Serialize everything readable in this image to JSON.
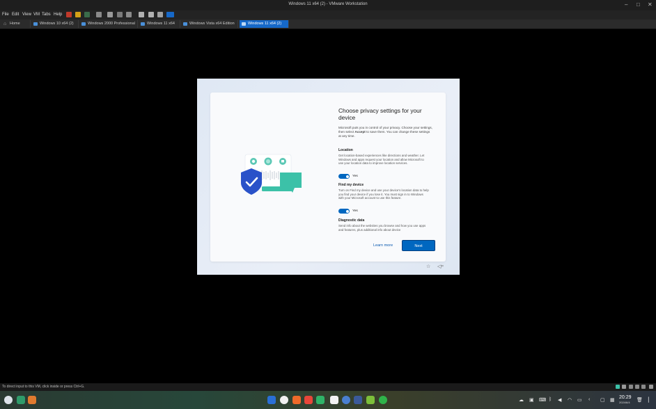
{
  "window": {
    "title": "Windows 11 x64 (2) - VMware Workstation"
  },
  "menu": [
    "File",
    "Edit",
    "View",
    "VM",
    "Tabs",
    "Help"
  ],
  "tabs": [
    {
      "label": "Home"
    },
    {
      "label": "Windows 10 x64 (2)"
    },
    {
      "label": "Windows 2000 Professional"
    },
    {
      "label": "Windows 11 x64"
    },
    {
      "label": "Windows Vista x64 Edition"
    },
    {
      "label": "Windows 11 x64 (2)"
    }
  ],
  "oobe": {
    "heading": "Choose privacy settings for your device",
    "description_pre": "Microsoft puts you in control of your privacy. Choose your settings, then select ",
    "description_bold": "Accept",
    "description_post": " to save them. You can change these settings at any time.",
    "sections": [
      {
        "title": "Location",
        "text": "Get location-based experiences like directions and weather. Let Windows and apps request your location and allow Microsoft to use your location data to improve location services.",
        "toggle": "Yes"
      },
      {
        "title": "Find my device",
        "text": "Turn on Find my device and use your device's location data to help you find your device if you lose it. You must sign in to Windows with your Microsoft account to use this feature.",
        "toggle": "Yes"
      },
      {
        "title": "Diagnostic data",
        "text": "Send info about the websites you browse and how you use apps and features, plus additional info about device"
      }
    ],
    "learn_more": "Learn more",
    "next": "Next"
  },
  "status": {
    "text": "To direct input to this VM, click inside or press Ctrl+G."
  },
  "clock": {
    "time": "20:29",
    "date": "2024/6/4"
  },
  "colors": {
    "accent": "#0067c0",
    "tab_active": "#1668c8"
  }
}
